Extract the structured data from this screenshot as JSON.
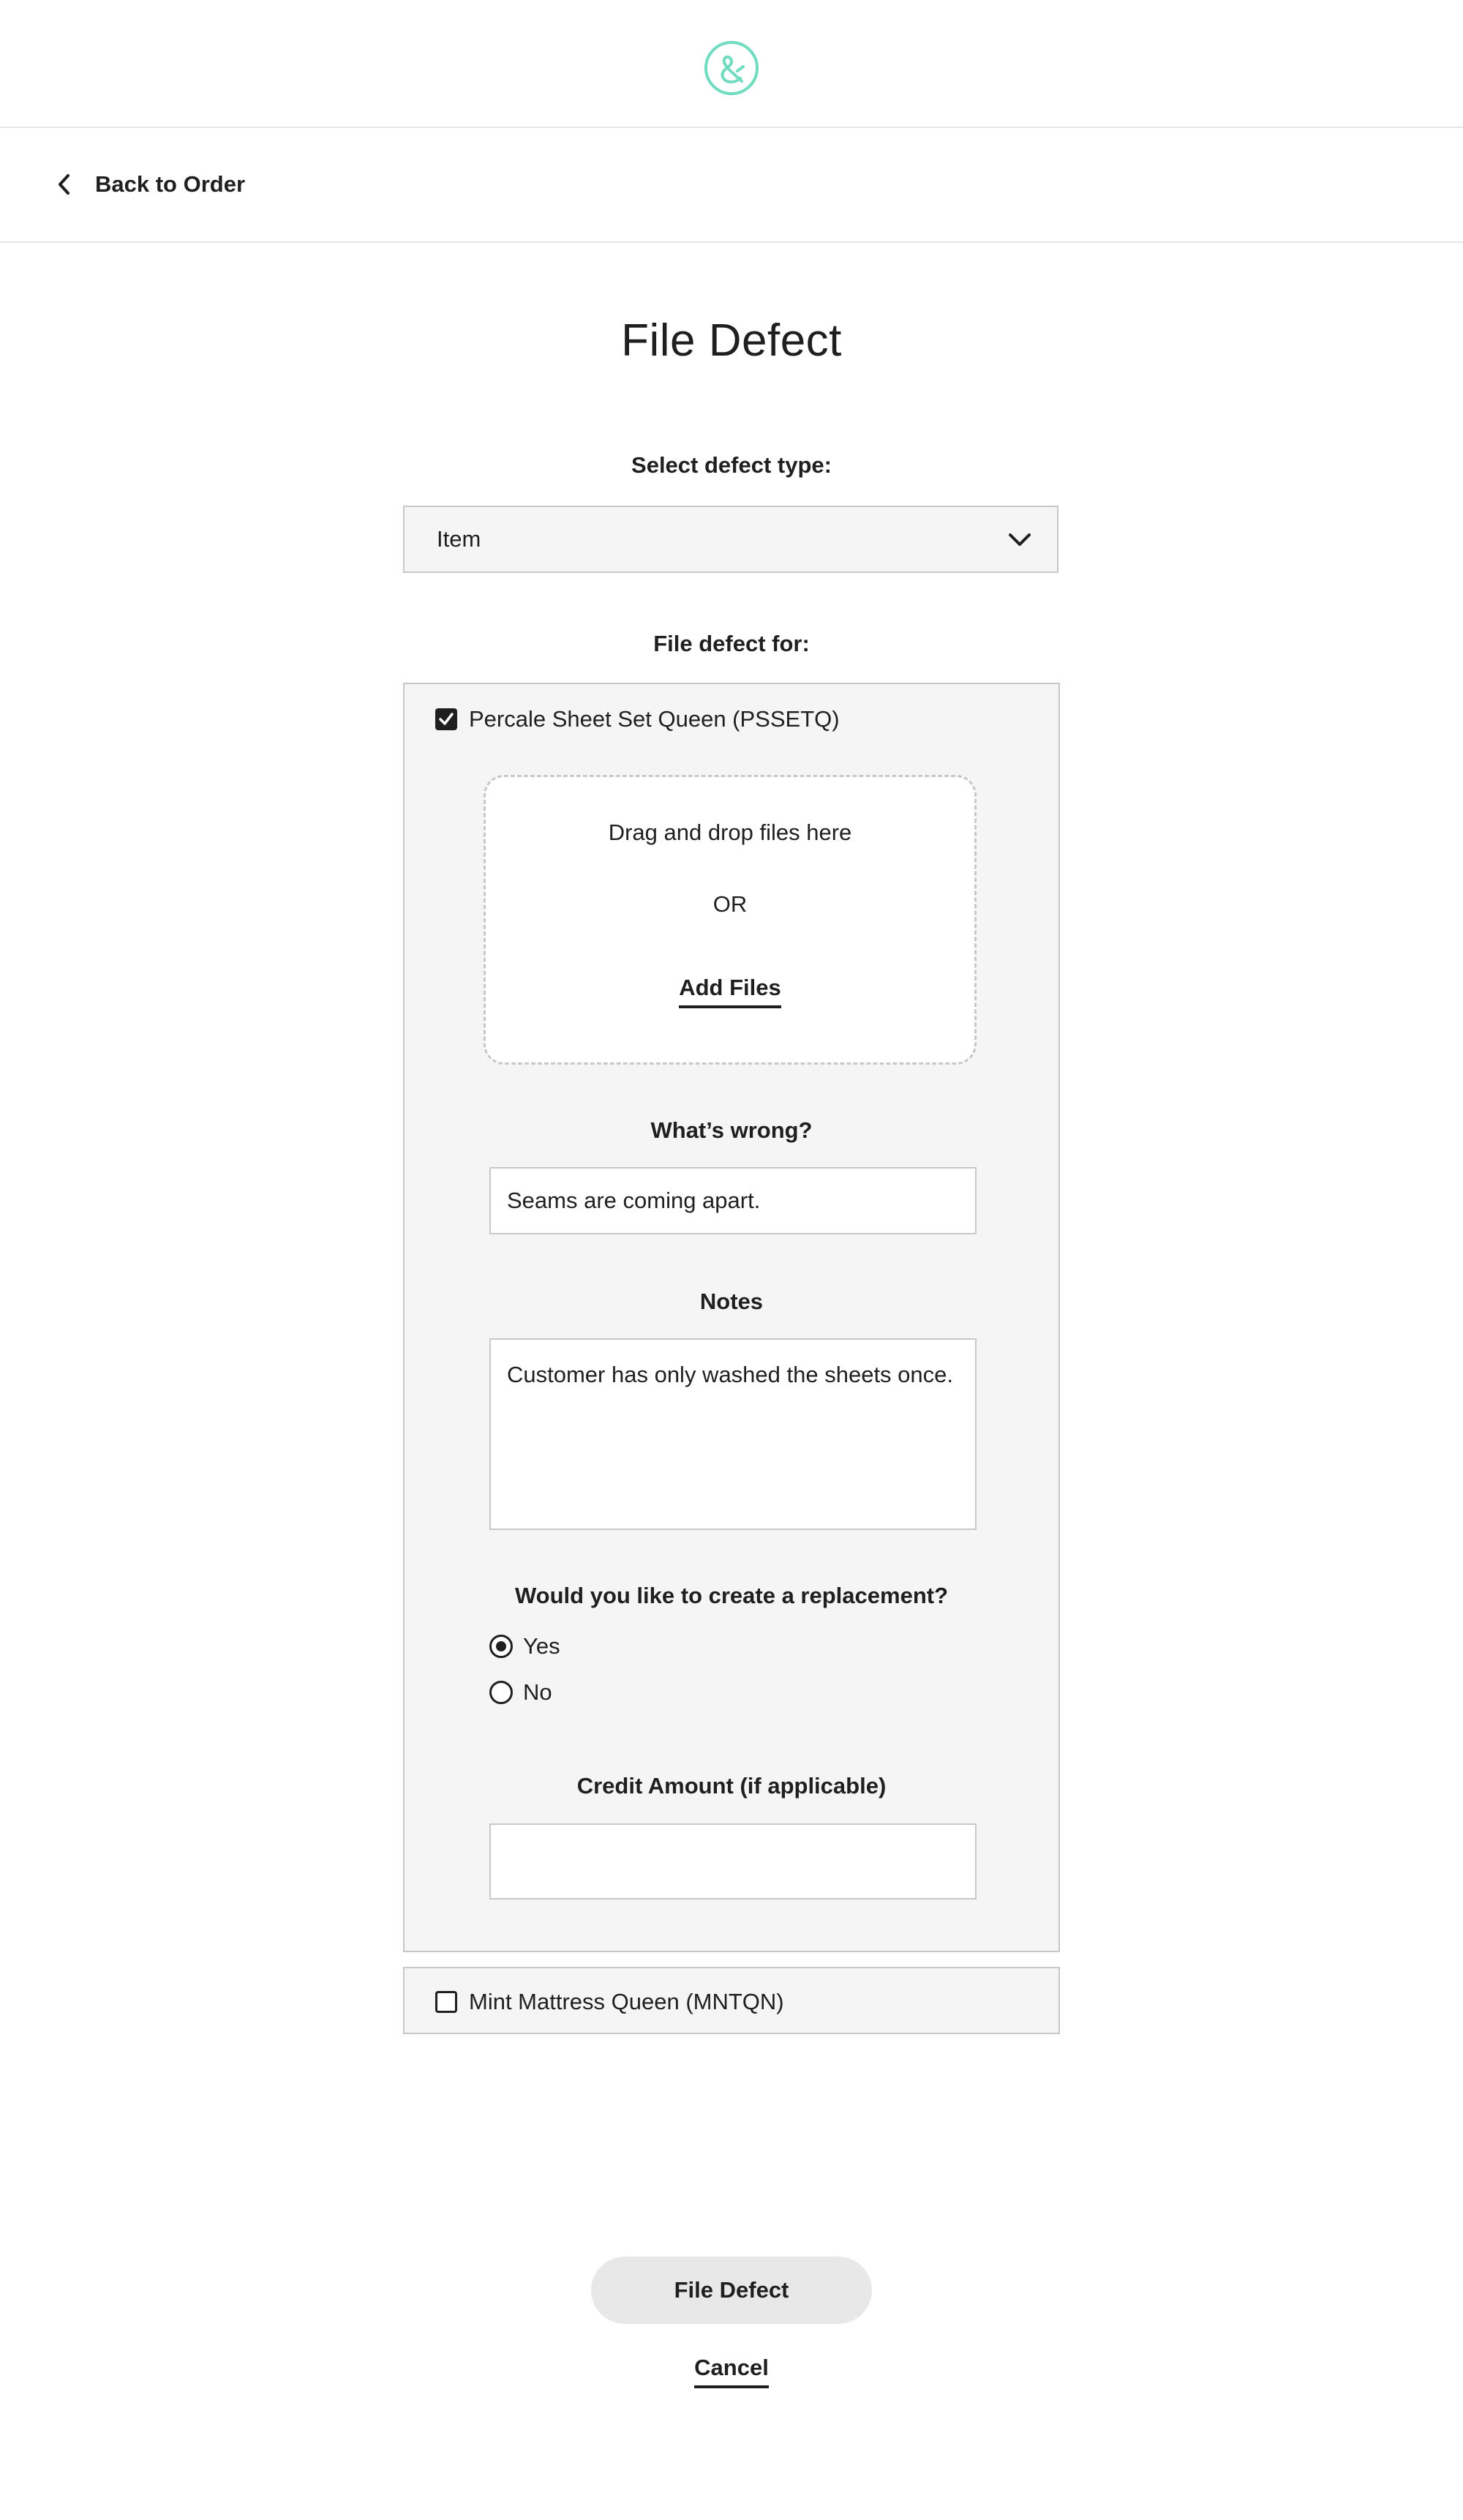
{
  "header": {
    "logo_icon": "ampersand-circle-logo",
    "logo_color": "#6fdcc0"
  },
  "nav": {
    "back_label": "Back to Order",
    "back_icon": "chevron-left-icon"
  },
  "page": {
    "title": "File Defect"
  },
  "defect_type": {
    "label": "Select defect type:",
    "selected": "Item",
    "icon": "chevron-down-icon"
  },
  "file_for": {
    "label": "File defect for:",
    "items": [
      {
        "name": "Percale Sheet Set Queen (PSSETQ)",
        "checked": true,
        "dropzone": {
          "text": "Drag and drop files here",
          "or": "OR",
          "add_files": "Add Files"
        },
        "whats_wrong": {
          "label": "What’s wrong?",
          "value": "Seams are coming apart."
        },
        "notes": {
          "label": "Notes",
          "value": "Customer has only washed the sheets once."
        },
        "replacement": {
          "label": "Would you like to create a replacement?",
          "options": [
            "Yes",
            "No"
          ],
          "selected": "Yes"
        },
        "credit": {
          "label": "Credit Amount (if applicable)",
          "value": ""
        }
      },
      {
        "name": "Mint Mattress Queen (MNTQN)",
        "checked": false
      }
    ]
  },
  "actions": {
    "submit_label": "File Defect",
    "cancel_label": "Cancel"
  }
}
